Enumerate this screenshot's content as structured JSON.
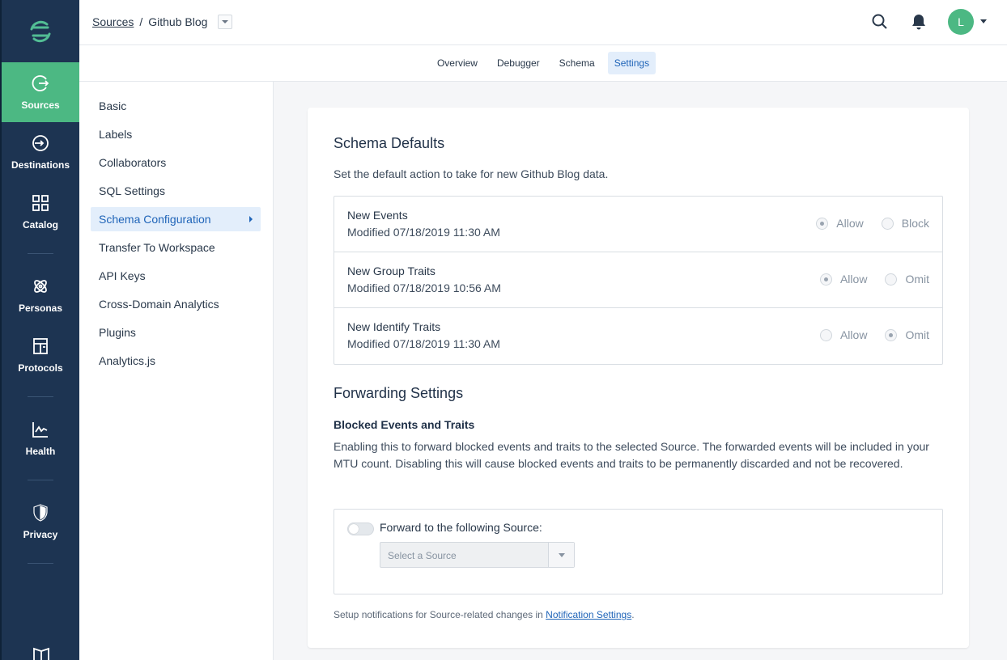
{
  "breadcrumb": {
    "root": "Sources",
    "separator": "/",
    "current": "Github Blog"
  },
  "user": {
    "initial": "L"
  },
  "rail": [
    {
      "label": "Sources",
      "icon": "sources-icon",
      "active": true
    },
    {
      "label": "Destinations",
      "icon": "destinations-icon"
    },
    {
      "label": "Catalog",
      "icon": "catalog-icon"
    },
    {
      "label": "Personas",
      "icon": "personas-icon"
    },
    {
      "label": "Protocols",
      "icon": "protocols-icon"
    },
    {
      "label": "Health",
      "icon": "health-icon"
    },
    {
      "label": "Privacy",
      "icon": "privacy-icon"
    }
  ],
  "tabs": [
    "Overview",
    "Debugger",
    "Schema",
    "Settings"
  ],
  "settings_nav": [
    "Basic",
    "Labels",
    "Collaborators",
    "SQL Settings",
    "Schema Configuration",
    "Transfer To Workspace",
    "API Keys",
    "Cross-Domain Analytics",
    "Plugins",
    "Analytics.js"
  ],
  "schema_defaults": {
    "title": "Schema Defaults",
    "description": "Set the default action to take for new Github Blog data.",
    "rows": [
      {
        "name": "New Events",
        "modified": "Modified 07/18/2019 11:30 AM",
        "options": [
          "Allow",
          "Block"
        ],
        "selected": "Allow"
      },
      {
        "name": "New Group Traits",
        "modified": "Modified 07/18/2019 10:56 AM",
        "options": [
          "Allow",
          "Omit"
        ],
        "selected": "Allow"
      },
      {
        "name": "New Identify Traits",
        "modified": "Modified 07/18/2019 11:30 AM",
        "options": [
          "Allow",
          "Omit"
        ],
        "selected": "Omit"
      }
    ]
  },
  "forwarding": {
    "title": "Forwarding Settings",
    "subtitle": "Blocked Events and Traits",
    "description": "Enabling this to forward blocked events and traits to the selected Source. The forwarded events will be included in your MTU count. Disabling this will cause blocked events and traits to be permanently discarded and not be recovered.",
    "toggle_label": "Forward to the following Source:",
    "select_placeholder": "Select a Source"
  },
  "note": {
    "text": "Setup notifications for Source-related changes in ",
    "link": "Notification Settings",
    "suffix": "."
  },
  "colors": {
    "rail": "#1d3452",
    "accent_green": "#4cb883",
    "active_blue": "#1f64b8"
  }
}
